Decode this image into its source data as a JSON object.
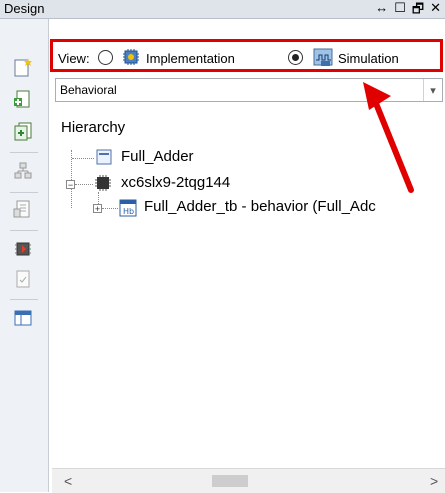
{
  "window": {
    "title": "Design",
    "controls": [
      "↔",
      "☐",
      "🗗",
      "✕"
    ]
  },
  "view": {
    "label": "View:",
    "options": [
      {
        "label": "Implementation",
        "selected": false,
        "icon": "implementation-chip-icon"
      },
      {
        "label": "Simulation",
        "selected": true,
        "icon": "simulation-icon"
      }
    ]
  },
  "dropdown": {
    "selected": "Behavioral"
  },
  "hierarchy": {
    "title": "Hierarchy",
    "items": [
      {
        "label": "Full_Adder",
        "icon": "project-icon"
      },
      {
        "label": "xc6slx9-2tqg144",
        "icon": "device-chip-icon"
      },
      {
        "label": "Full_Adder_tb - behavior (Full_Adc",
        "icon": "vhdl-testbench-icon"
      }
    ]
  },
  "scrollbar": {
    "left": "<",
    "right": ">"
  },
  "colors": {
    "highlight": "#e00000",
    "arrow": "#e00000"
  }
}
